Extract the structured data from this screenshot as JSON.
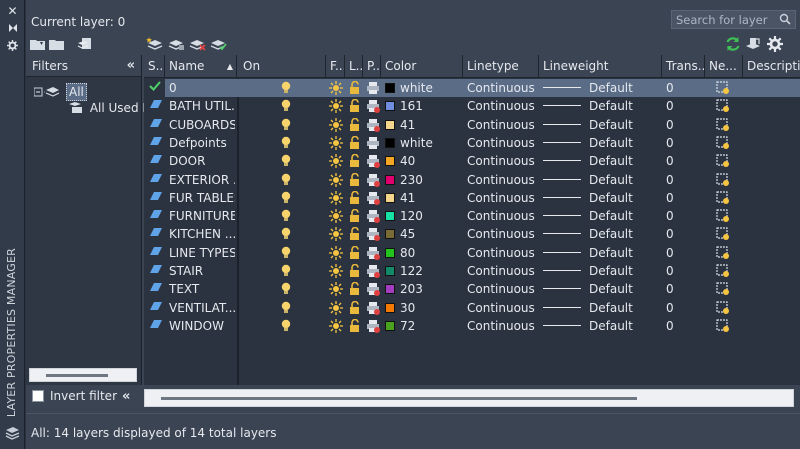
{
  "panel": {
    "title": "LAYER PROPERTIES MANAGER",
    "current_layer_label": "Current layer: 0",
    "search_placeholder": "Search for layer"
  },
  "filters": {
    "header": "Filters",
    "tree": [
      {
        "label": "All",
        "selected": true
      },
      {
        "label": "All Used L..."
      }
    ],
    "invert_filter_label": "Invert filter",
    "invert_filter_checked": false
  },
  "grid": {
    "columns": [
      "S...",
      "Name",
      "On",
      "F...",
      "L...",
      "P...",
      "Color",
      "Linetype",
      "Lineweight",
      "Trans...",
      "Ne...",
      "Descripti"
    ],
    "rows": [
      {
        "name": "0",
        "color_name": "white",
        "color_hex": "#000000",
        "linetype": "Continuous",
        "lineweight": "Default",
        "transparency": "0",
        "current": true,
        "selected": true
      },
      {
        "name": "BATH UTIL...",
        "color_name": "161",
        "color_hex": "#6f8ee0",
        "linetype": "Continuous",
        "lineweight": "Default",
        "transparency": "0"
      },
      {
        "name": "CUBOARDS",
        "color_name": "41",
        "color_hex": "#f3d58b",
        "linetype": "Continuous",
        "lineweight": "Default",
        "transparency": "0"
      },
      {
        "name": "Defpoints",
        "color_name": "white",
        "color_hex": "#000000",
        "linetype": "Continuous",
        "lineweight": "Default",
        "transparency": "0"
      },
      {
        "name": "DOOR",
        "color_name": "40",
        "color_hex": "#f5a623",
        "linetype": "Continuous",
        "lineweight": "Default",
        "transparency": "0"
      },
      {
        "name": "EXTERIOR ...",
        "color_name": "230",
        "color_hex": "#e0006e",
        "linetype": "Continuous",
        "lineweight": "Default",
        "transparency": "0"
      },
      {
        "name": "FUR TABLES",
        "color_name": "41",
        "color_hex": "#f3d58b",
        "linetype": "Continuous",
        "lineweight": "Default",
        "transparency": "0"
      },
      {
        "name": "FURNITURE",
        "color_name": "120",
        "color_hex": "#16e0a4",
        "linetype": "Continuous",
        "lineweight": "Default",
        "transparency": "0"
      },
      {
        "name": "KITCHEN ...",
        "color_name": "45",
        "color_hex": "#7a6a36",
        "linetype": "Continuous",
        "lineweight": "Default",
        "transparency": "0"
      },
      {
        "name": "LINE TYPES",
        "color_name": "80",
        "color_hex": "#22c31d",
        "linetype": "Continuous",
        "lineweight": "Default",
        "transparency": "0"
      },
      {
        "name": "STAIR",
        "color_name": "122",
        "color_hex": "#138a6a",
        "linetype": "Continuous",
        "lineweight": "Default",
        "transparency": "0"
      },
      {
        "name": "TEXT",
        "color_name": "203",
        "color_hex": "#a43dbf",
        "linetype": "Continuous",
        "lineweight": "Default",
        "transparency": "0"
      },
      {
        "name": "VENTILAT...",
        "color_name": "30",
        "color_hex": "#f57a05",
        "linetype": "Continuous",
        "lineweight": "Default",
        "transparency": "0"
      },
      {
        "name": "WINDOW",
        "color_name": "72",
        "color_hex": "#48a21e",
        "linetype": "Continuous",
        "lineweight": "Default",
        "transparency": "0"
      }
    ]
  },
  "status": "All: 14 layers displayed of 14 total layers",
  "icons": {
    "on": "lightbulb-on-icon",
    "freeze": "sun-thaw-icon",
    "lock": "padlock-unlocked-icon",
    "plot": "printer-icon",
    "new_vp_freeze": "viewport-freeze-icon"
  }
}
